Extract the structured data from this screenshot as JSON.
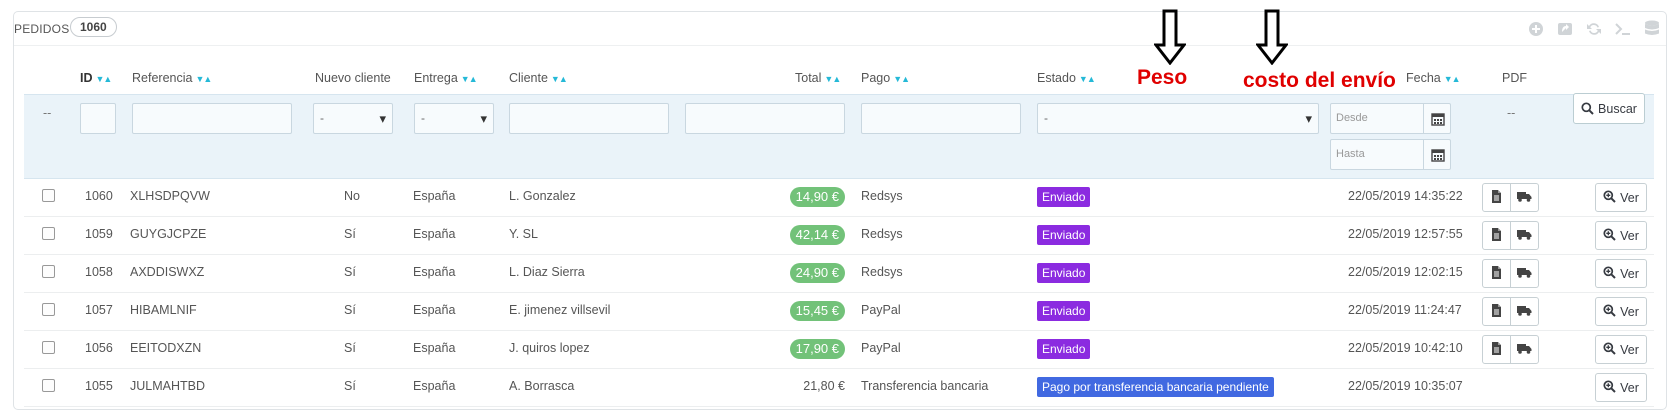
{
  "panel": {
    "title": "PEDIDOS",
    "count": "1060"
  },
  "toolbar": {
    "icons": [
      "add-icon",
      "export-icon",
      "refresh-icon",
      "sql-terminal-icon",
      "database-icon"
    ]
  },
  "columns": {
    "id": "ID",
    "referencia": "Referencia",
    "nuevo_cliente": "Nuevo cliente",
    "entrega": "Entrega",
    "cliente": "Cliente",
    "total": "Total",
    "pago": "Pago",
    "estado": "Estado",
    "fecha": "Fecha",
    "pdf": "PDF"
  },
  "filters": {
    "id_placeholder": "--",
    "nuevo_cliente_selected": "-",
    "entrega_selected": "-",
    "estado_selected": "-",
    "desde_placeholder": "Desde",
    "hasta_placeholder": "Hasta",
    "pdf_placeholder": "--",
    "buscar_label": "Buscar"
  },
  "annotations": {
    "peso": "Peso",
    "costo": "costo del envío"
  },
  "colors": {
    "total_pill": "#72c279",
    "enviado": "#8b2be0",
    "pago_pendiente": "#4169e1",
    "annotation": "#e00000"
  },
  "orders": [
    {
      "id": "1060",
      "ref": "XLHSDPQVW",
      "nuevo": "No",
      "entrega": "España",
      "cliente": "L. Gonzalez",
      "total": "14,90 €",
      "pago": "Redsys",
      "estado": "Enviado",
      "estado_kind": "enviado",
      "fecha": "22/05/2019 14:35:22",
      "has_pdf": true,
      "ver": "Ver"
    },
    {
      "id": "1059",
      "ref": "GUYGJCPZE",
      "nuevo": "Sí",
      "entrega": "España",
      "cliente": "Y. SL",
      "total": "42,14 €",
      "pago": "Redsys",
      "estado": "Enviado",
      "estado_kind": "enviado",
      "fecha": "22/05/2019 12:57:55",
      "has_pdf": true,
      "ver": "Ver"
    },
    {
      "id": "1058",
      "ref": "AXDDISWXZ",
      "nuevo": "Sí",
      "entrega": "España",
      "cliente": "L. Diaz Sierra",
      "total": "24,90 €",
      "pago": "Redsys",
      "estado": "Enviado",
      "estado_kind": "enviado",
      "fecha": "22/05/2019 12:02:15",
      "has_pdf": true,
      "ver": "Ver"
    },
    {
      "id": "1057",
      "ref": "HIBAMLNIF",
      "nuevo": "Sí",
      "entrega": "España",
      "cliente": "E. jimenez villsevil",
      "total": "15,45 €",
      "pago": "PayPal",
      "estado": "Enviado",
      "estado_kind": "enviado",
      "fecha": "22/05/2019 11:24:47",
      "has_pdf": true,
      "ver": "Ver"
    },
    {
      "id": "1056",
      "ref": "EEITODXZN",
      "nuevo": "Sí",
      "entrega": "España",
      "cliente": "J. quiros lopez",
      "total": "17,90 €",
      "pago": "PayPal",
      "estado": "Enviado",
      "estado_kind": "enviado",
      "fecha": "22/05/2019 10:42:10",
      "has_pdf": true,
      "ver": "Ver"
    },
    {
      "id": "1055",
      "ref": "JULMAHTBD",
      "nuevo": "Sí",
      "entrega": "España",
      "cliente": "A. Borrasca",
      "total": "21,80 €",
      "pago": "Transferencia bancaria",
      "estado": "Pago por transferencia bancaria pendiente",
      "estado_kind": "pending",
      "fecha": "22/05/2019 10:35:07",
      "has_pdf": false,
      "ver": "Ver"
    }
  ]
}
